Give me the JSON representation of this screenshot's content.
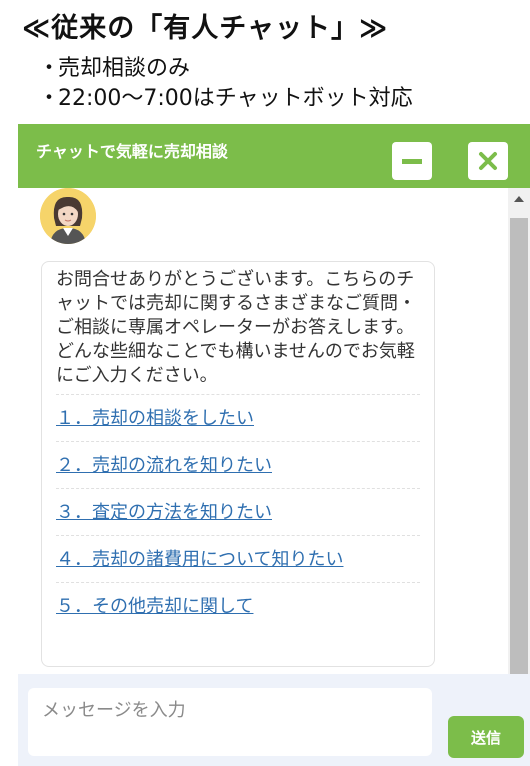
{
  "heading": {
    "title": "≪従来の「有人チャット」≫",
    "bullets": [
      "売却相談のみ",
      "22:00〜7:00はチャットボット対応"
    ],
    "bullet_mark": "・"
  },
  "chat": {
    "title": "チャットで気軽に売却相談",
    "header_color": "#7cbd4a",
    "minimize_icon": "minus-icon",
    "close_icon": "close-icon",
    "avatar": "operator-avatar",
    "message": "お問合せありがとうございます。こちらのチャットでは売却に関するさまざまなご質問・ご相談に専属オペレーターがお答えします。どんな些細なことでも構いませんのでお気軽にご入力ください。",
    "options": [
      "１．売却の相談をしたい",
      "２．売却の流れを知りたい",
      "３．査定の方法を知りたい",
      "４．売却の諸費用について知りたい",
      "５．その他売却に関して"
    ],
    "link_color": "#2f6fb0",
    "input_placeholder": "メッセージを入力",
    "input_value": "",
    "send_label": "送信"
  }
}
